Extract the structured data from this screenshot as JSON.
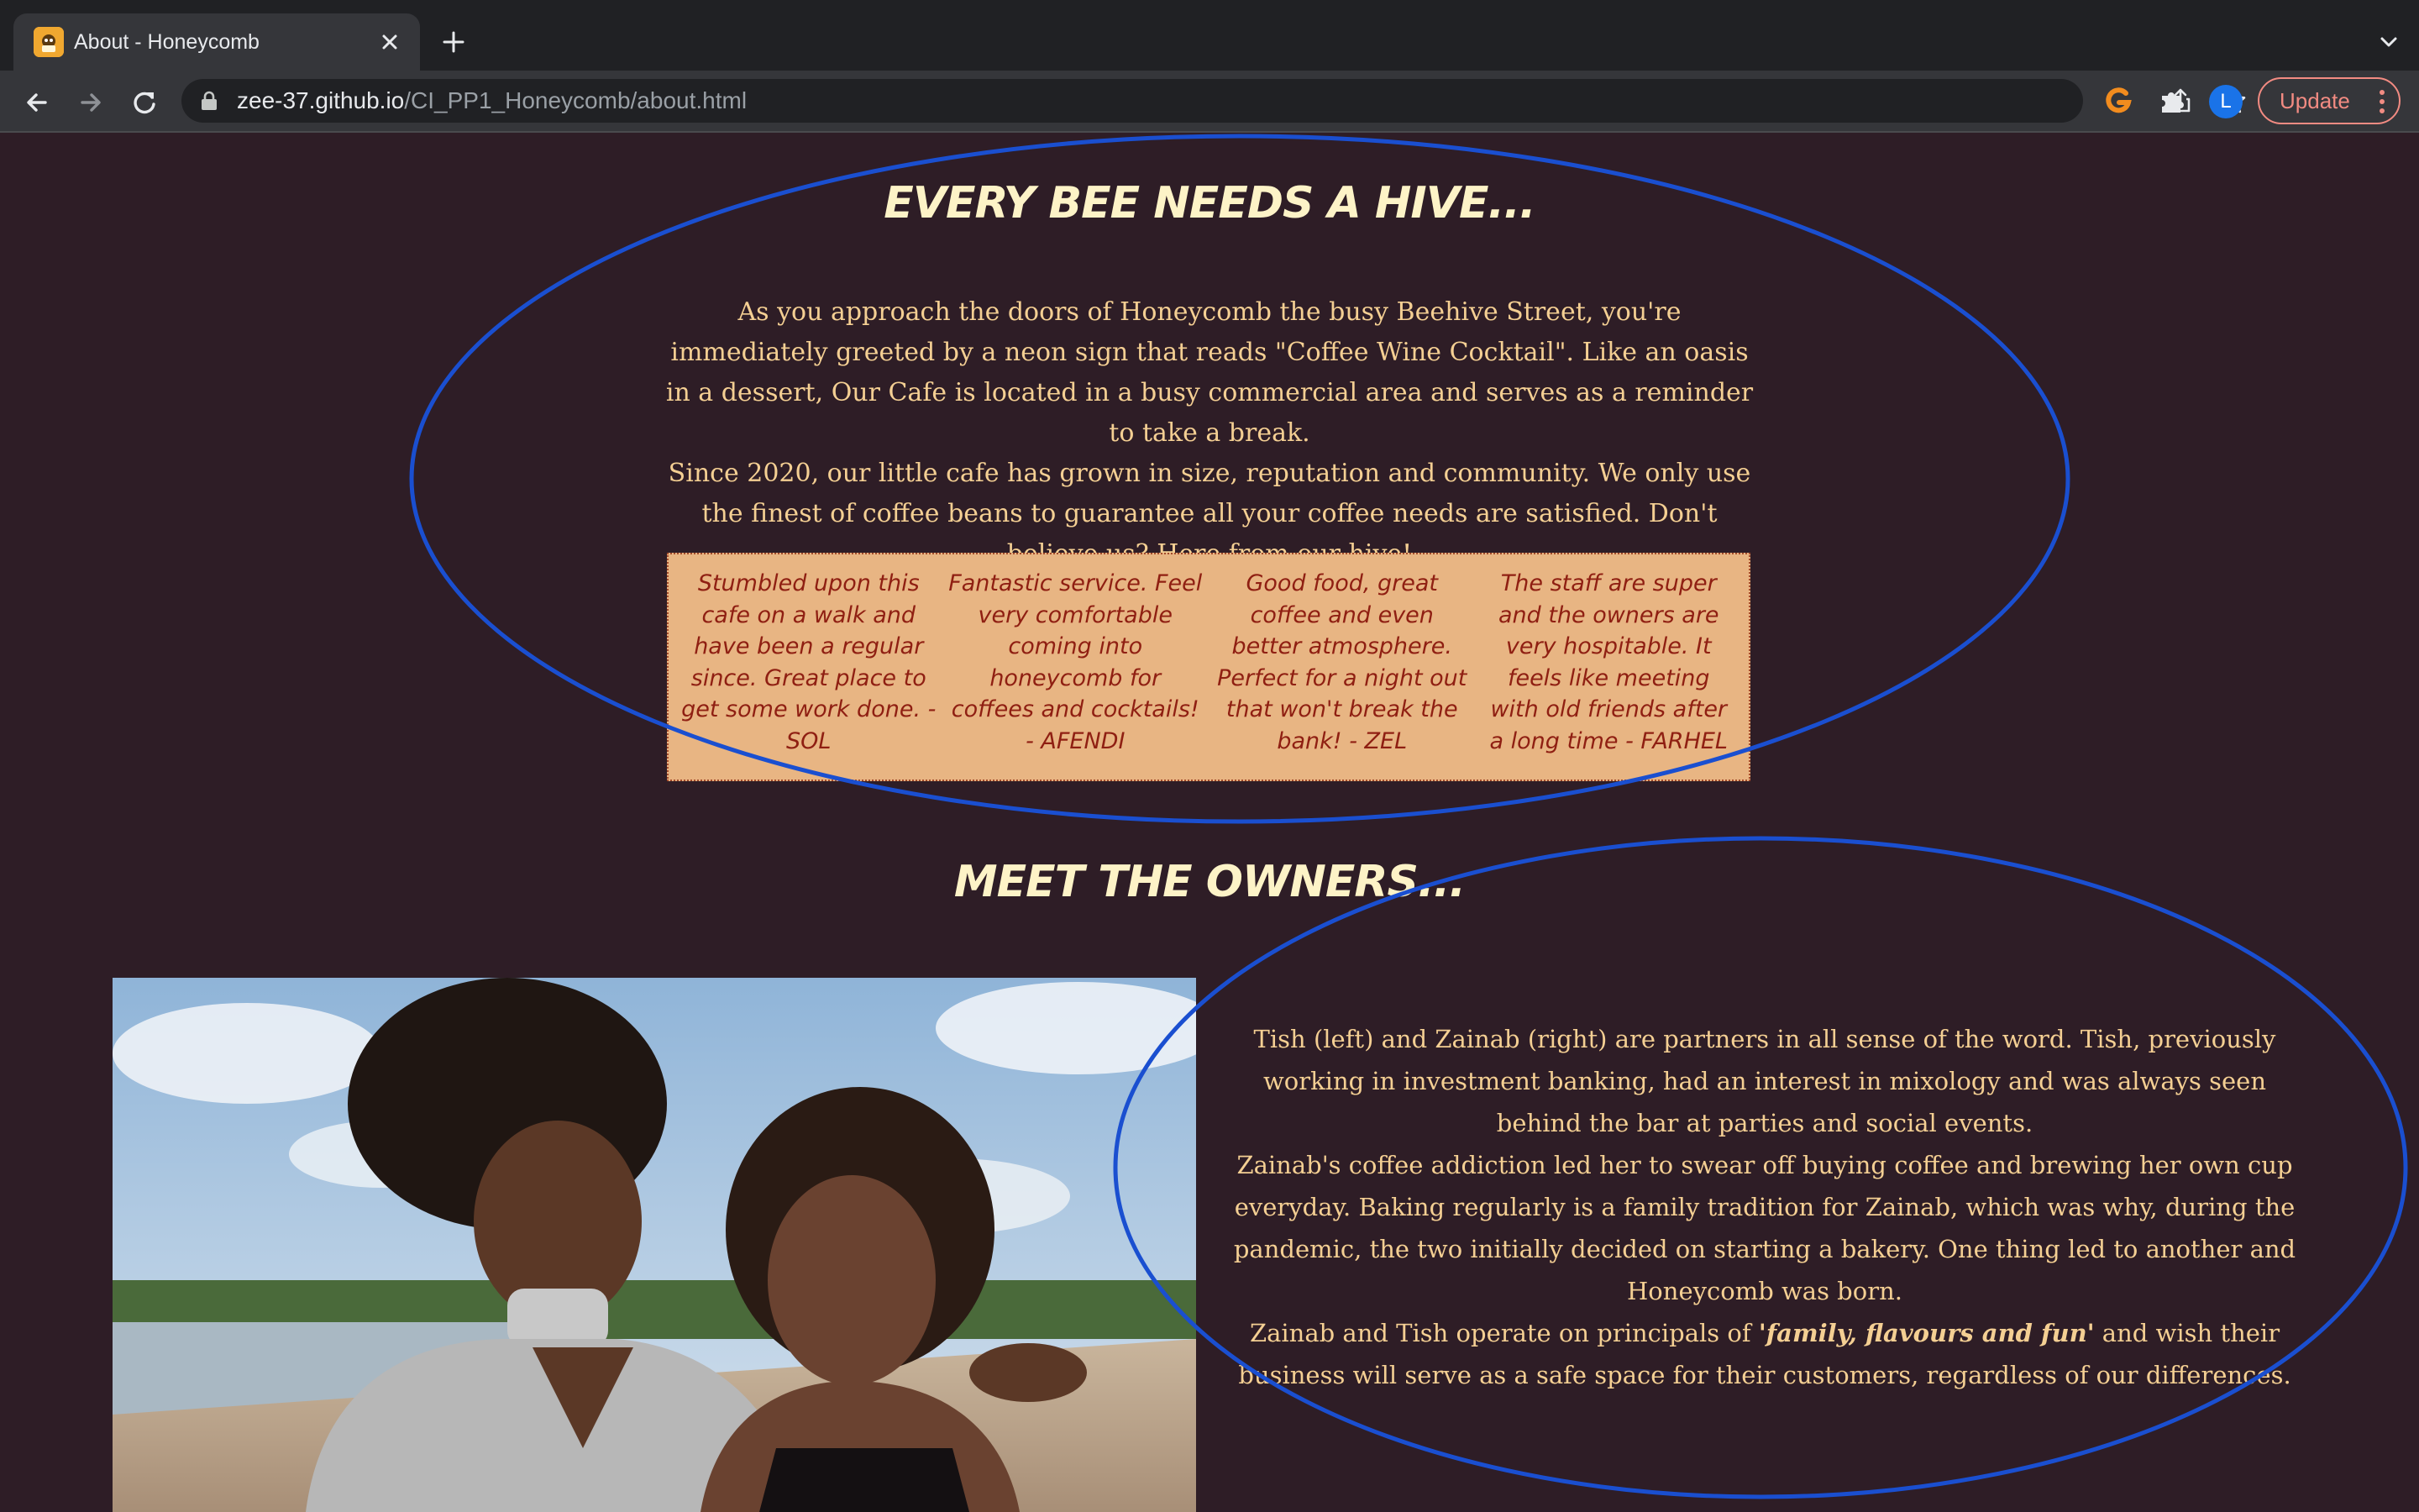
{
  "browser": {
    "tab_title": "About - Honeycomb",
    "url_host": "zee-37.github.io",
    "url_path": "/CI_PP1_Honeycomb/about.html",
    "profile_initial": "L",
    "update_label": "Update",
    "accent_color": "#1a73e8",
    "update_color": "#f28b82"
  },
  "page": {
    "background_color": "#2e1d26",
    "hive": {
      "heading": "EVERY BEE NEEDS A HIVE...",
      "intro_paragraph_1": "As you approach the doors of Honeycomb the busy Beehive Street, you're immediately greeted by a neon sign that reads \"Coffee Wine Cocktail\". Like an oasis in a dessert, Our Cafe is located in a busy commercial area and serves as a reminder to take a break.",
      "intro_paragraph_2": "Since 2020, our little cafe has grown in size, reputation and community. We only use the finest of coffee beans to guarantee all your coffee needs are satisfied. Don't believe us? Here from our hive!",
      "reviews": [
        {
          "text": "Stumbled upon this cafe on a walk and have been a regular since. Great place to get some work done. - SOL"
        },
        {
          "text": "Fantastic service. Feel very comfortable coming into honeycomb for coffees and cocktails! - AFENDI"
        },
        {
          "text": "Good food, great coffee and even better atmosphere. Perfect for a night out that won't break the bank! - ZEL"
        },
        {
          "text": "The staff are super and the owners are very hospitable. It feels like meeting with old friends after a long time - FARHEL"
        }
      ]
    },
    "owners": {
      "heading": "MEET THE OWNERS...",
      "paragraph_1": "Tish (left) and Zainab (right) are partners in all sense of the word. Tish, previously working in investment banking, had an interest in mixology and was always seen behind the bar at parties and social events.",
      "paragraph_2": "Zainab's coffee addiction led her to swear off buying coffee and brewing her own cup everyday. Baking regularly is a family tradition for Zainab, which was why, during the pandemic, the two initially decided on starting a bakery. One thing led to another and Honeycomb was born.",
      "paragraph_3_start": "Zainab and Tish operate on principals of ",
      "paragraph_3_motto": "'family, flavours and fun'",
      "paragraph_3_end": " and wish their business will serve as a safe space for their customers, regardless of our differences."
    }
  },
  "annotation_color": "#1a4fd0"
}
